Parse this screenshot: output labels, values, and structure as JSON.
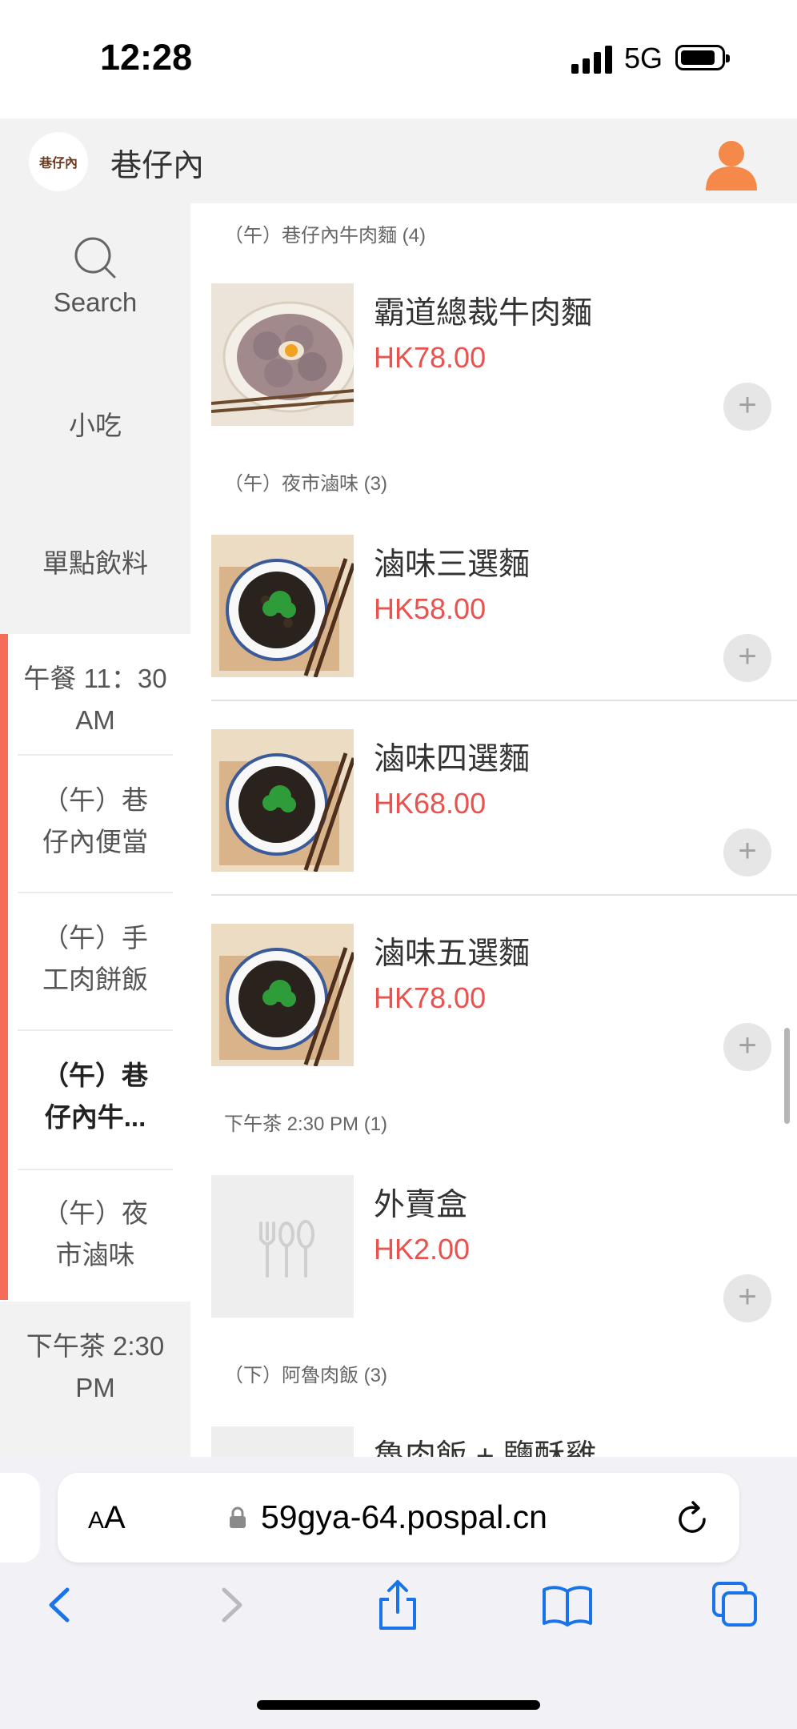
{
  "status_bar": {
    "time": "12:28",
    "network": "5G"
  },
  "header": {
    "logo_text": "巷仔內",
    "store_name": "巷仔內"
  },
  "sidebar": {
    "search_label": "Search",
    "items": [
      {
        "label": "小吃"
      },
      {
        "label": "單點飲料"
      },
      {
        "label_line1": "午餐 11：30",
        "label_line2": "AM"
      },
      {
        "label_line1": "（午）巷",
        "label_line2": "仔內便當"
      },
      {
        "label_line1": "（午）手",
        "label_line2": "工肉餅飯"
      },
      {
        "label_line1": "（午）巷",
        "label_line2": "仔內牛..."
      },
      {
        "label_line1": "（午）夜",
        "label_line2": "市滷味"
      },
      {
        "label_line1": "下午茶 2:30",
        "label_line2": "PM"
      }
    ]
  },
  "sections": [
    {
      "title": "（午）巷仔內牛肉麵 (4)"
    },
    {
      "title": "（午）夜市滷味 (3)"
    },
    {
      "title": "下午茶 2:30 PM (1)"
    },
    {
      "title": "（下）阿魯肉飯 (3)"
    }
  ],
  "products": [
    {
      "name": "霸道總裁牛肉麵",
      "price": "HK78.00"
    },
    {
      "name": "滷味三選麵",
      "price": "HK58.00"
    },
    {
      "name": "滷味四選麵",
      "price": "HK68.00"
    },
    {
      "name": "滷味五選麵",
      "price": "HK78.00"
    },
    {
      "name": "外賣盒",
      "price": "HK2.00"
    },
    {
      "name": "魯肉飯 + 鹽酥雞"
    }
  ],
  "add_symbol": "+",
  "browser": {
    "aa_small": "A",
    "aa_large": "A",
    "url": "59gya-64.pospal.cn"
  },
  "colors": {
    "accent": "#f56c58",
    "price": "#e8524f",
    "user_icon": "#f5894a"
  }
}
